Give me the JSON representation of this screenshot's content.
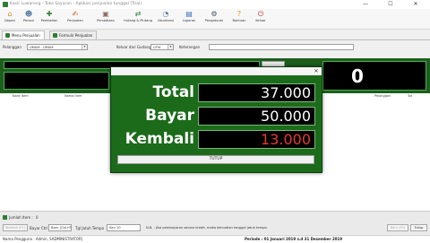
{
  "window": {
    "title": "Kasir Luwareng - Toko Sayuran - Aplikasi penjualan tunggal (Trial)",
    "controls": {
      "minimize": "—",
      "maximize": "☐",
      "close": "✕"
    }
  },
  "toolbar": [
    {
      "label": "Depan",
      "icon": "home-icon",
      "glyph": "⌂",
      "color": "#d9822b"
    },
    {
      "label": "Person",
      "icon": "people-icon",
      "glyph": "☻",
      "color": "#5b7fa6"
    },
    {
      "label": "Pembelian",
      "icon": "purchase-icon",
      "glyph": "✚",
      "color": "#2e7d32"
    },
    {
      "label": "Penjualan",
      "icon": "sales-icon",
      "glyph": "✍",
      "color": "#c65a1e"
    },
    {
      "label": "Persediaan",
      "icon": "inventory-icon",
      "glyph": "▣",
      "color": "#8d6e63"
    },
    {
      "label": "Hutang & Piutang",
      "icon": "debt-icon",
      "glyph": "⇄",
      "color": "#2e7d32"
    },
    {
      "label": "Akuntansi",
      "icon": "accounting-icon",
      "glyph": "◔",
      "color": "#5b7fa6"
    },
    {
      "label": "Laporan",
      "icon": "report-icon",
      "glyph": "▤",
      "color": "#3f6fb5"
    },
    {
      "label": "Pengaturan",
      "icon": "settings-icon",
      "glyph": "⚙",
      "color": "#455a64"
    },
    {
      "label": "Bantuan",
      "icon": "help-icon",
      "glyph": "?",
      "color": "#e0a000"
    },
    {
      "label": "Keluar",
      "icon": "power-icon",
      "glyph": "⏻",
      "color": "#c62828"
    }
  ],
  "tabs": {
    "active": "Menu Penjualan",
    "second": "Formulir Penjualan"
  },
  "filters": {
    "pelanggan_label": "Pelanggan",
    "pelanggan_value": "UMUM - UMUM",
    "keluar_label": "Keluar dari Gudang",
    "keluar_value": "UTM",
    "keterangan_label": "Keterangan",
    "keterangan_value": ""
  },
  "total_display": "0",
  "table": {
    "columns": [
      "Kode Item",
      "Nama Item",
      "Pelanggan",
      "Tot"
    ]
  },
  "bottom": {
    "jumlah_label": "Jumlah Item :",
    "jumlah_value": "0",
    "tambah_button": "Tambah (F1)",
    "bayar_label": "Bayar Ctrl",
    "bayar_value": "Baru [Ctrl+B]",
    "jatuh_tempo_label": "Tgl Jatuh Tempo",
    "jatuh_tempo_value": "Sen 10",
    "note": "N.B. : Jika pembayaran secara kredit, maka kemudian tanggal jatuh tempo.",
    "baru_button": "Baru (F2)",
    "tutup_button": "Tutup"
  },
  "status": {
    "left": "Nama Pengguna : Admin, SADMINISTRATOR]",
    "right": "Periode : 01 Januari 2019 s.d 31 Desember 2019"
  },
  "modal": {
    "close": "✕",
    "total_label": "Total",
    "total_value": "37.000",
    "bayar_label": "Bayar",
    "bayar_value": "50.000",
    "kembali_label": "Kembali",
    "kembali_value": "13.000",
    "close_button": "TUTUP"
  },
  "colors": {
    "accent_green": "#1b6b1b",
    "value_white": "#ffffff",
    "value_red": "#e53935"
  }
}
